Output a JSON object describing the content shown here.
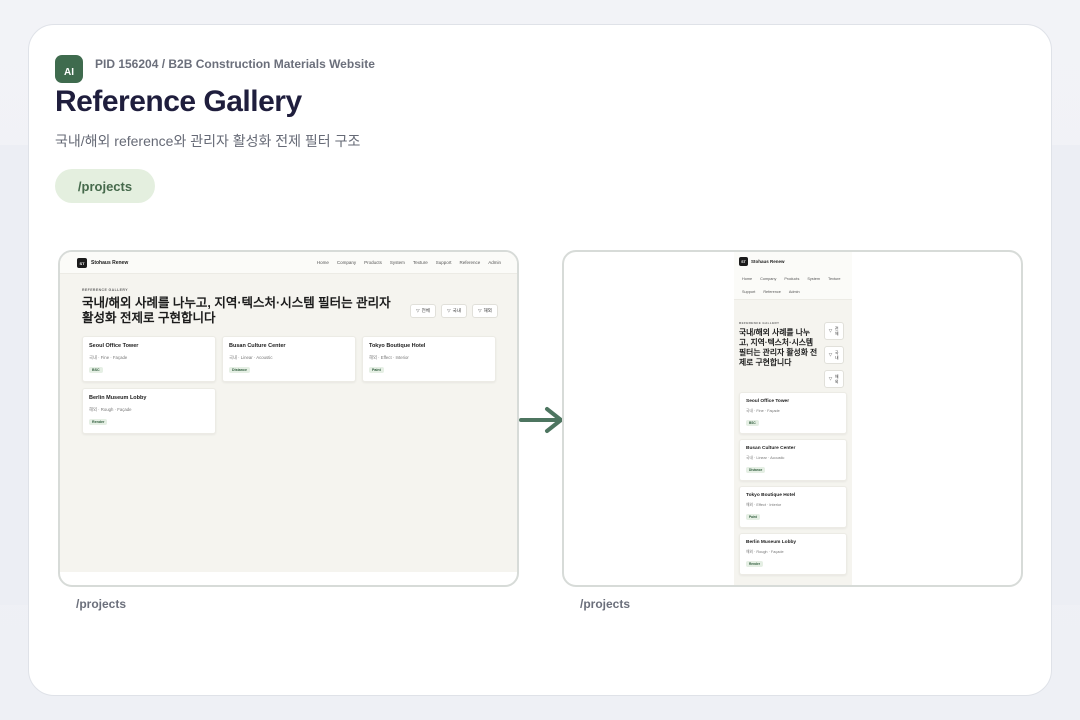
{
  "header": {
    "ai_badge": "AI",
    "pid": "PID 156204 / B2B Construction Materials Website",
    "title": "Reference Gallery",
    "subtitle": "국내/해외 reference와 관리자 활성화 전제 필터 구조",
    "route": "/projects"
  },
  "screens": {
    "desktop_label": "/projects",
    "mobile_label": "/projects"
  },
  "site": {
    "logo_mark": "ST",
    "brand": "Stohaus Renew",
    "nav": [
      "Home",
      "Company",
      "Products",
      "System",
      "Texture",
      "Support",
      "Reference",
      "Admin"
    ],
    "eyebrow": "REFERENCE GALLERY",
    "headline": "국내/해외 사례를 나누고, 지역·텍스처·시스템 필터는 관리자 활성화 전제로 구현합니다",
    "filters": [
      "전체",
      "국내",
      "해외"
    ],
    "references": [
      {
        "title": "Seoul Office Tower",
        "meta": "국내 · Fine · Façade",
        "tag": "BSC"
      },
      {
        "title": "Busan Culture Center",
        "meta": "국내 · Linear · Acoustic",
        "tag": "Distance"
      },
      {
        "title": "Tokyo Boutique Hotel",
        "meta": "해외 · Effect · Interior",
        "tag": "Paint"
      },
      {
        "title": "Berlin Museum Lobby",
        "meta": "해외 · Rough · Façade",
        "tag": "Render"
      }
    ]
  },
  "colors": {
    "badge": "#3f6b4e",
    "title": "#1f1e3d",
    "pill_bg": "#e4efdf",
    "pill_text": "#466a4c",
    "arrow": "#4d7560"
  },
  "icons": {
    "filter": "filter-funnel-icon",
    "arrow": "arrow-right-icon"
  }
}
